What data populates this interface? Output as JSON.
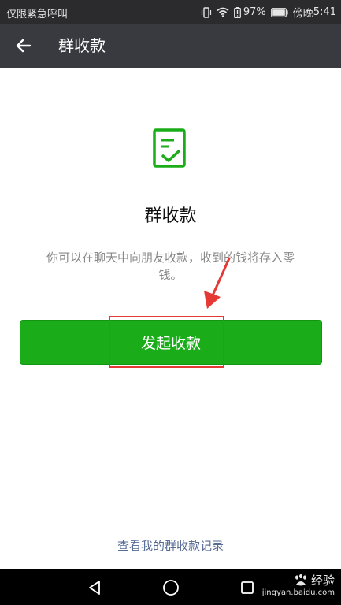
{
  "status_bar": {
    "left_text": "仅限紧急呼叫",
    "battery": "97%",
    "carrier": "傍晚",
    "time": "5:41",
    "icons": [
      "vibrate-icon",
      "wifi-icon",
      "battery-alert-icon",
      "battery-icon"
    ]
  },
  "header": {
    "title": "群收款",
    "back_icon": "back-arrow-icon"
  },
  "main": {
    "icon": "checklist-icon",
    "heading": "群收款",
    "description": "你可以在聊天中向朋友收款，收到的钱将存入零钱。",
    "primary_button": "发起收款",
    "records_link": "查看我的群收款记录"
  },
  "nav_bar": {
    "buttons": [
      "back-triangle-icon",
      "home-circle-icon",
      "recent-square-icon"
    ]
  },
  "watermark": {
    "brand": "经验",
    "url": "jingyan.baidu.com"
  },
  "colors": {
    "status_bg": "#2b2b2d",
    "header_bg": "#393a3f",
    "accent_green": "#1aad19",
    "link_blue": "#576b95",
    "annotation_red": "#e53935"
  }
}
